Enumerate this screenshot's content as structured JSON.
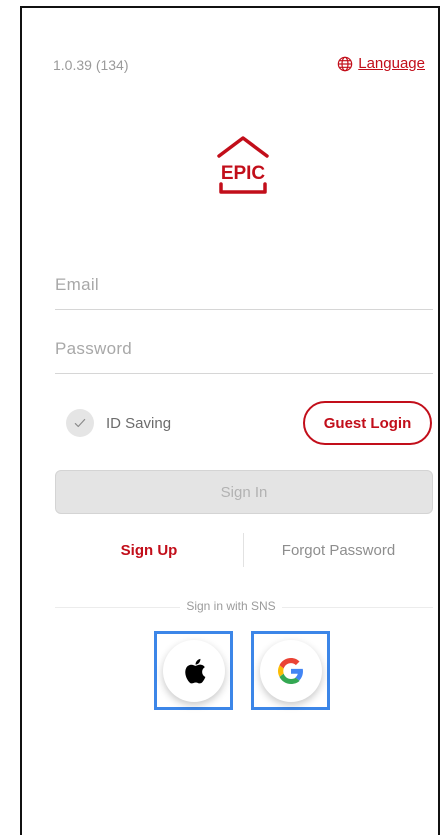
{
  "header": {
    "version": "1.0.39 (134)",
    "language_label": "Language"
  },
  "logo": {
    "text": "EPIC",
    "brand_color": "#c20e1a"
  },
  "form": {
    "email_placeholder": "Email",
    "password_placeholder": "Password",
    "id_saving_label": "ID Saving",
    "guest_login_label": "Guest Login",
    "sign_in_label": "Sign In"
  },
  "links": {
    "sign_up": "Sign Up",
    "forgot_password": "Forgot Password"
  },
  "sns": {
    "label": "Sign in with SNS",
    "providers": [
      {
        "icon": "apple-icon"
      },
      {
        "icon": "google-icon"
      }
    ]
  },
  "colors": {
    "accent": "#c20e1a",
    "highlight_border": "#3c86e8",
    "disabled_button": "#e4e4e4"
  }
}
